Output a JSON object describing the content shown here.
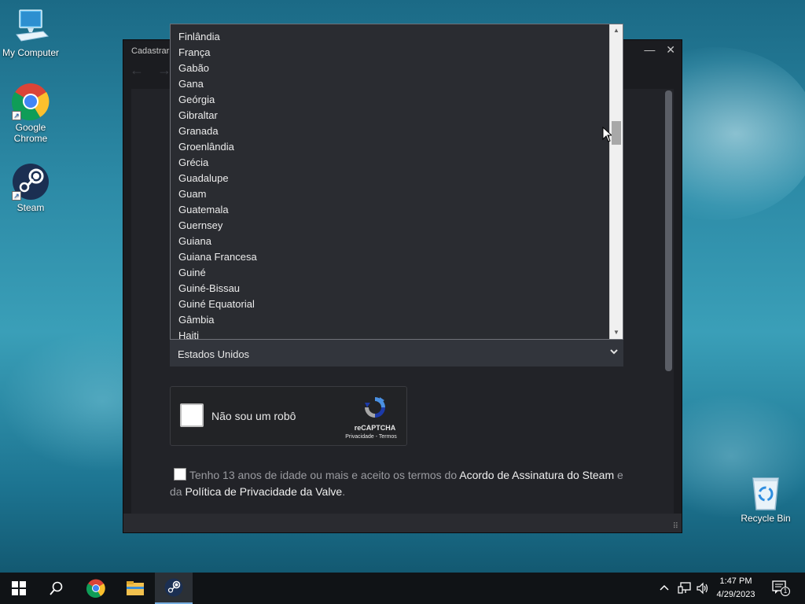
{
  "desktop": {
    "icons": [
      {
        "label": "My Computer"
      },
      {
        "label": "Google Chrome"
      },
      {
        "label": "Steam"
      },
      {
        "label": "Recycle Bin"
      }
    ]
  },
  "window": {
    "title": "Cadastrar",
    "controls": {
      "minimize": "—",
      "close": "✕"
    }
  },
  "dropdown": {
    "items": [
      "Finlândia",
      "França",
      "Gabão",
      "Gana",
      "Geórgia",
      "Gibraltar",
      "Granada",
      "Groenlândia",
      "Grécia",
      "Guadalupe",
      "Guam",
      "Guatemala",
      "Guernsey",
      "Guiana",
      "Guiana Francesa",
      "Guiné",
      "Guiné-Bissau",
      "Guiné Equatorial",
      "Gâmbia",
      "Haiti"
    ]
  },
  "country_select": {
    "value": "Estados Unidos"
  },
  "captcha": {
    "label": "Não sou um robô",
    "brand": "reCAPTCHA",
    "links": "Privacidade - Termos"
  },
  "agreement": {
    "text1": "Tenho 13 anos de idade ou mais e aceito os termos do ",
    "link1": "Acordo de Assinatura do Steam",
    "text2": " e da ",
    "link2": "Política de Privacidade da Valve",
    "text3": "."
  },
  "taskbar": {
    "time": "1:47 PM",
    "date": "4/29/2023",
    "notification_count": "1"
  },
  "colors": {
    "steam_bg": "#1b1c20",
    "panel_bg": "#222328",
    "accent": "#77aee0"
  }
}
